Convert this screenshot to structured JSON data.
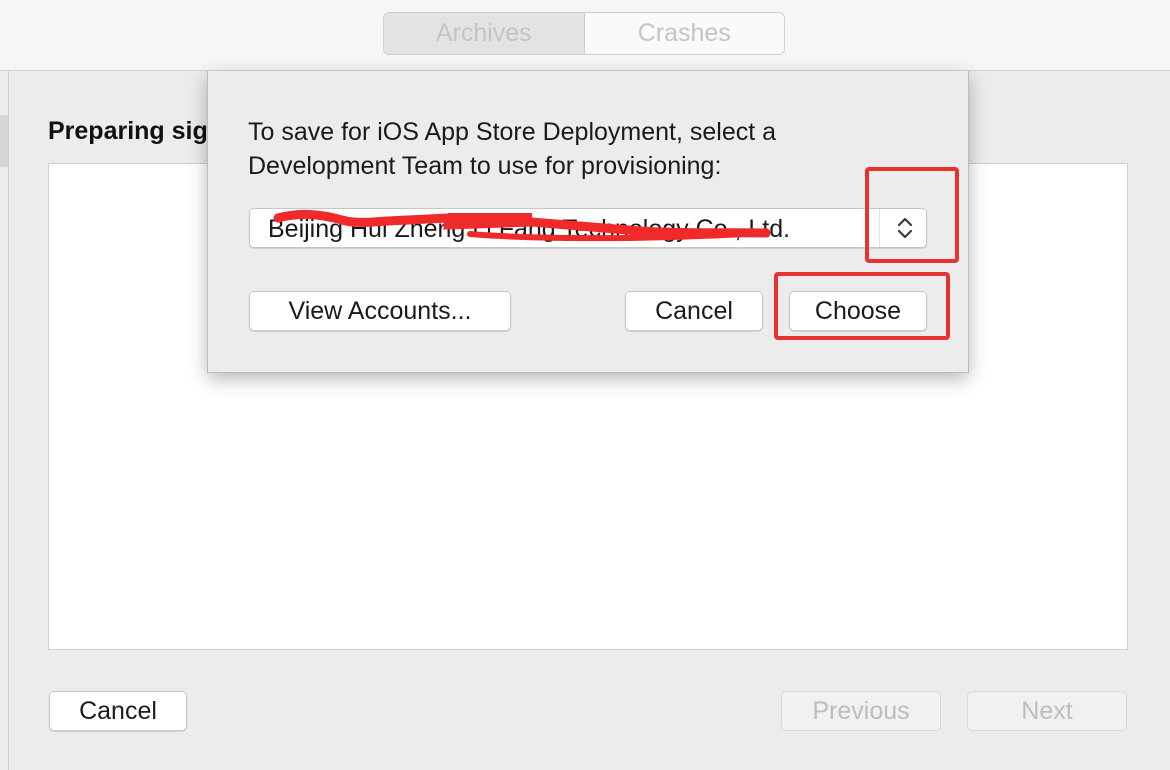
{
  "toolbar": {
    "segments": [
      {
        "label": "Archives",
        "selected": true
      },
      {
        "label": "Crashes",
        "selected": false
      }
    ]
  },
  "sheet": {
    "title": "Preparing signing",
    "buttons": {
      "cancel": "Cancel",
      "previous": "Previous",
      "next": "Next"
    }
  },
  "dialog": {
    "message": "To save for iOS App Store Deployment, select a Development Team to use for provisioning:",
    "team_popup": {
      "selected_value": "Beijing Hui Zheng Li Fang Technology Co., Ltd.",
      "icon": "up-down-chevron-icon"
    },
    "buttons": {
      "view_accounts": "View Accounts...",
      "cancel": "Cancel",
      "choose": "Choose"
    }
  },
  "annotations": {
    "color": "#e8322f",
    "redaction_color": "#f0292a"
  },
  "colors": {
    "window_bg": "#ececec",
    "disabled_text": "#bdbdbd"
  }
}
